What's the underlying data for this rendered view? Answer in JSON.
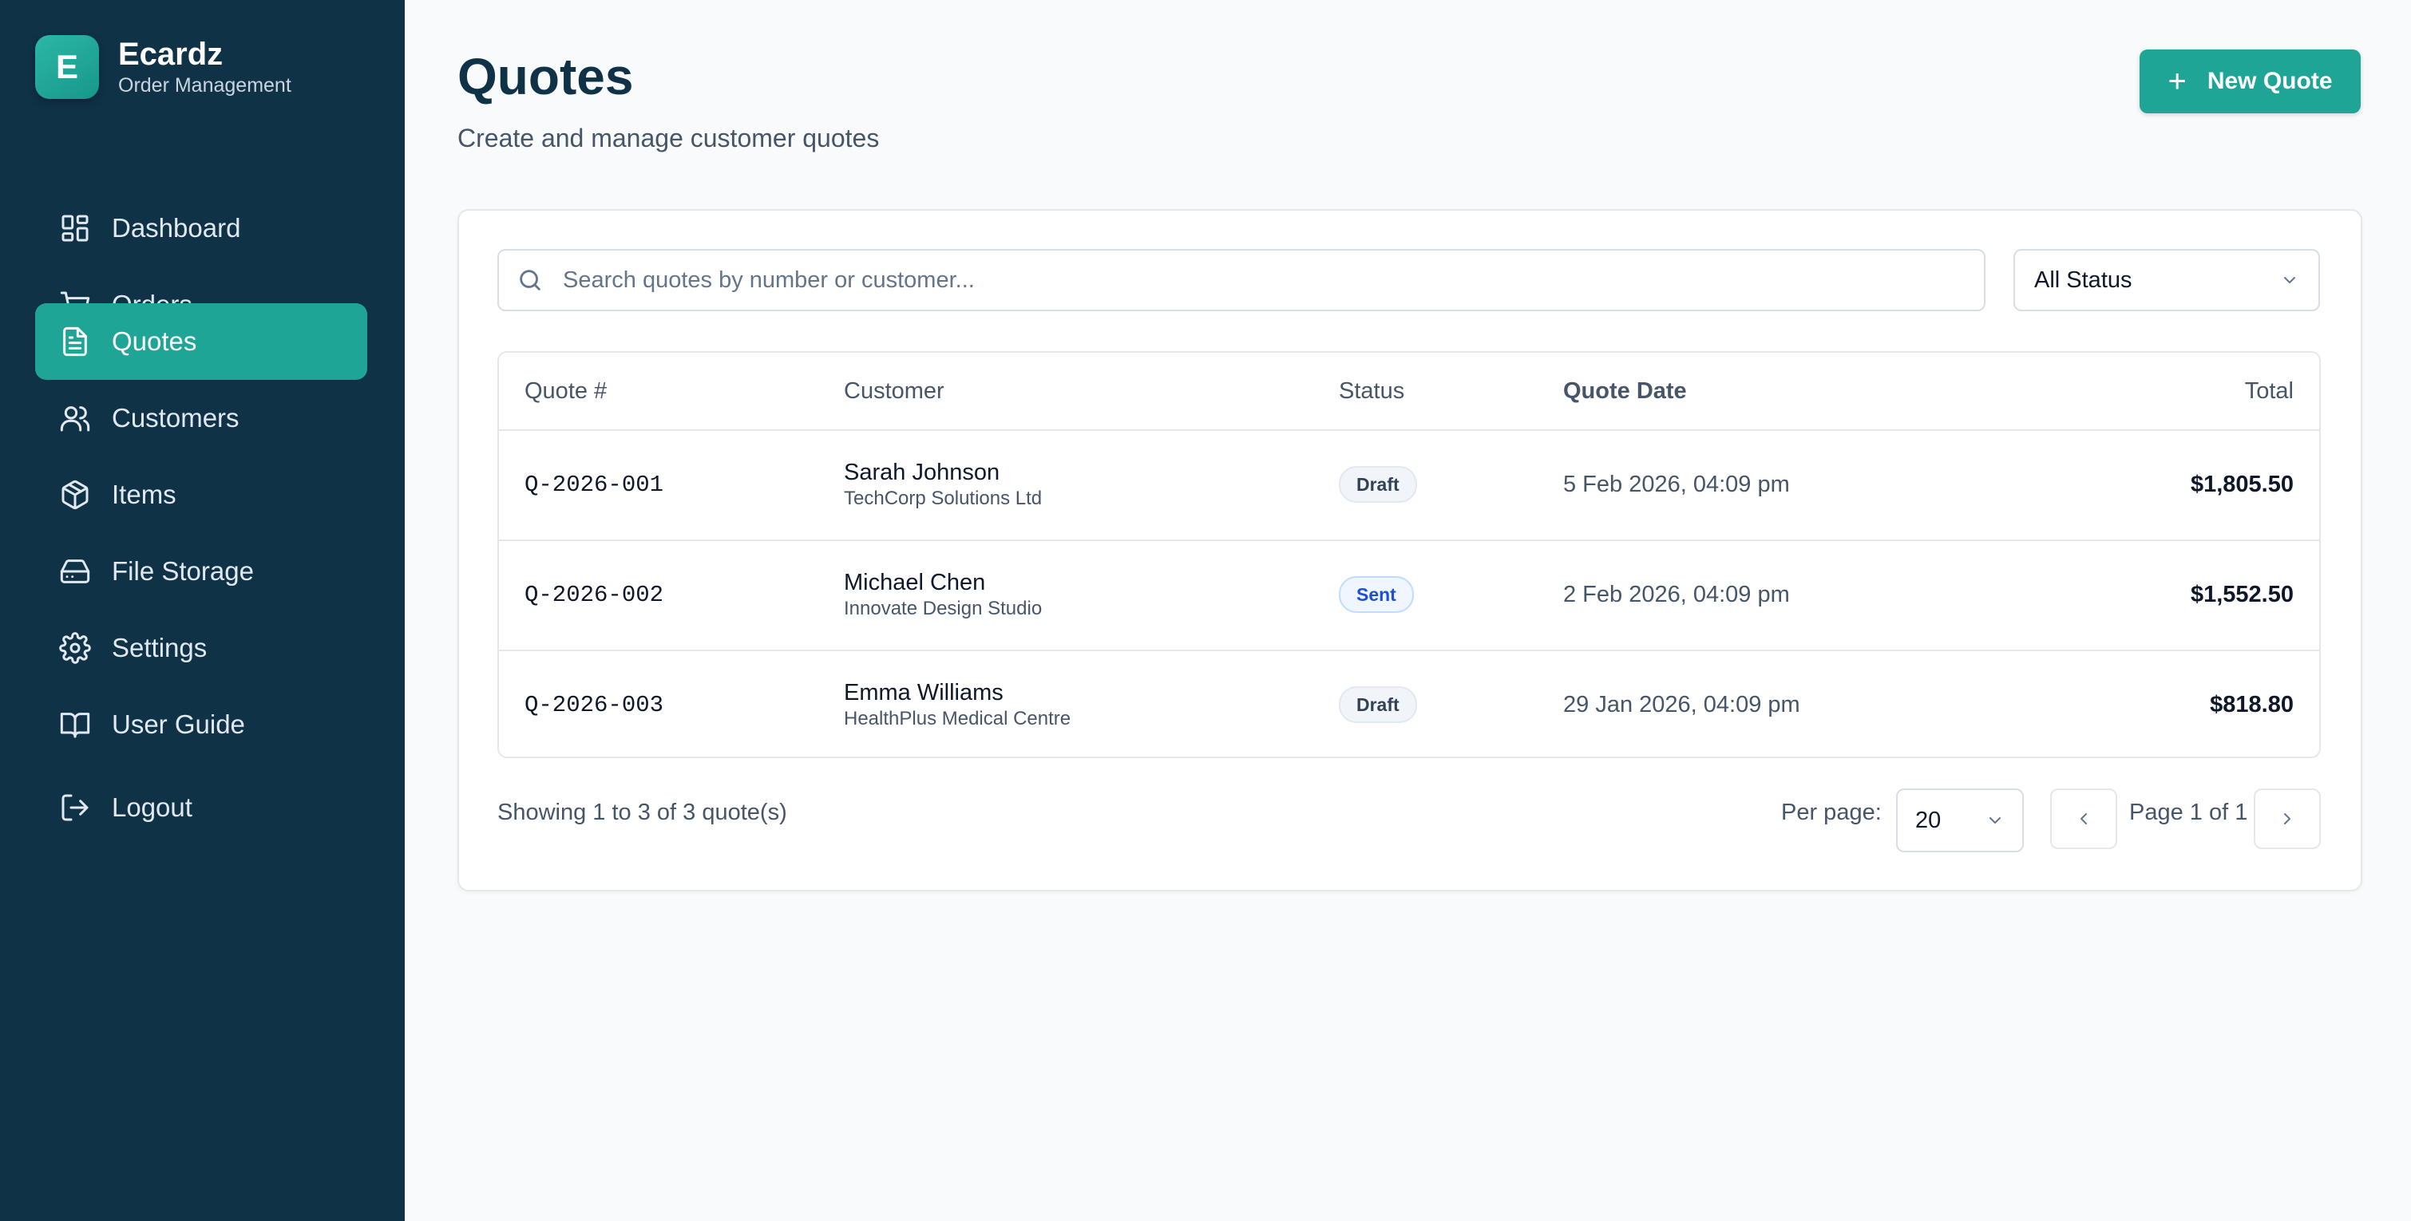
{
  "brand": {
    "logo_letter": "E",
    "name": "Ecardz",
    "subtitle": "Order Management"
  },
  "sidebar": {
    "items": [
      {
        "label": "Dashboard",
        "icon": "dashboard-icon",
        "active": false
      },
      {
        "label": "Orders",
        "icon": "cart-icon",
        "active": false
      },
      {
        "label": "Quotes",
        "icon": "document-icon",
        "active": true
      },
      {
        "label": "Customers",
        "icon": "users-icon",
        "active": false
      },
      {
        "label": "Items",
        "icon": "box-icon",
        "active": false
      },
      {
        "label": "File Storage",
        "icon": "hard-drive-icon",
        "active": false
      },
      {
        "label": "Settings",
        "icon": "gear-icon",
        "active": false
      },
      {
        "label": "User Guide",
        "icon": "book-icon",
        "active": false
      },
      {
        "label": "Logout",
        "icon": "logout-icon",
        "active": false
      }
    ]
  },
  "header": {
    "title": "Quotes",
    "subtitle": "Create and manage customer quotes",
    "new_button_label": "New Quote",
    "new_button_icon": "plus-icon"
  },
  "filters": {
    "search_placeholder": "Search quotes by number or customer...",
    "search_value": "",
    "status_selected": "All Status"
  },
  "table": {
    "columns": [
      "Quote #",
      "Customer",
      "Status",
      "Quote Date",
      "Total"
    ],
    "rows": [
      {
        "quote_number": "Q-2026-001",
        "customer_name": "Sarah Johnson",
        "company": "TechCorp Solutions Ltd",
        "status": "Draft",
        "date": "5 Feb 2026, 04:09 pm",
        "total": "$1,805.50"
      },
      {
        "quote_number": "Q-2026-002",
        "customer_name": "Michael Chen",
        "company": "Innovate Design Studio",
        "status": "Sent",
        "date": "2 Feb 2026, 04:09 pm",
        "total": "$1,552.50"
      },
      {
        "quote_number": "Q-2026-003",
        "customer_name": "Emma Williams",
        "company": "HealthPlus Medical Centre",
        "status": "Draft",
        "date": "29 Jan 2026, 04:09 pm",
        "total": "$818.80"
      }
    ]
  },
  "pagination": {
    "showing_text": "Showing 1 to 3 of 3 quote(s)",
    "per_page_label": "Per page:",
    "per_page_value": "20",
    "page_info": "Page 1 of 1"
  },
  "colors": {
    "sidebar_bg": "#0f3247",
    "accent": "#1fa596",
    "title": "#0f3247",
    "draft_badge_bg": "#f1f5f9",
    "sent_badge_bg": "#eff6ff",
    "sent_badge_text": "#1d4ed8"
  }
}
